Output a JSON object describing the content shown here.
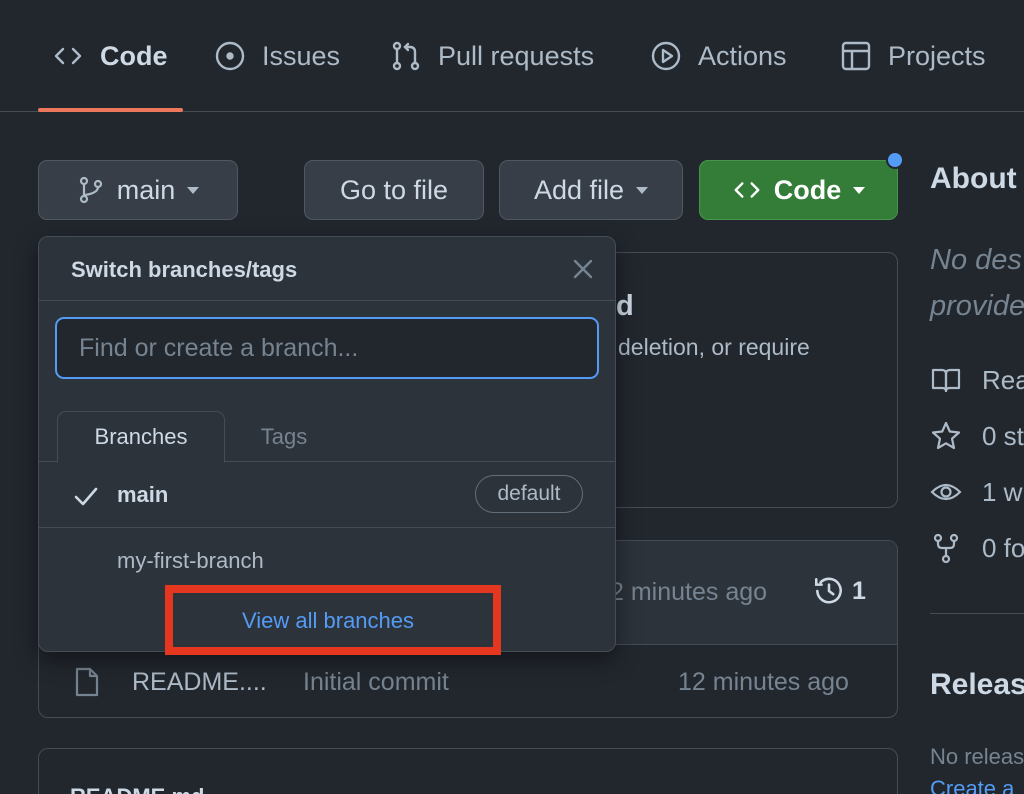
{
  "nav": {
    "tabs": [
      {
        "label": "Code",
        "icon": "code-icon",
        "active": true
      },
      {
        "label": "Issues",
        "icon": "issue-opened-icon"
      },
      {
        "label": "Pull requests",
        "icon": "git-pull-request-icon"
      },
      {
        "label": "Actions",
        "icon": "play-icon"
      },
      {
        "label": "Projects",
        "icon": "table-icon"
      }
    ]
  },
  "toolbar": {
    "branch_label": "main",
    "go_to_file": "Go to file",
    "add_file": "Add file",
    "code": "Code"
  },
  "background": {
    "protect_title_fragment": "d",
    "protect_desc_fragment": "deletion, or require",
    "commit_time": "2 minutes ago",
    "commit_count": "1",
    "file_name": "README....",
    "file_commit_message": "Initial commit",
    "file_time": "12 minutes ago",
    "readme_header_fragment": "README.md"
  },
  "about": {
    "title": "About",
    "desc_line1": "No des",
    "desc_line2": "provide",
    "readme": "Rea",
    "stars": "0 st",
    "watchers": "1 w",
    "forks": "0 fo",
    "releases_title": "Releas",
    "no_releases": "No releas",
    "create_release": "Create a"
  },
  "dropdown": {
    "title": "Switch branches/tags",
    "search_placeholder": "Find or create a branch...",
    "tabs": {
      "branches": "Branches",
      "tags": "Tags"
    },
    "branches": [
      {
        "name": "main",
        "selected": true,
        "badge": "default"
      },
      {
        "name": "my-first-branch"
      }
    ],
    "view_all": "View all branches"
  },
  "colors": {
    "accent_blue": "#539bf5",
    "green_button": "#347d39",
    "tab_underline": "#ec775c",
    "highlight_box": "#e5371f"
  }
}
